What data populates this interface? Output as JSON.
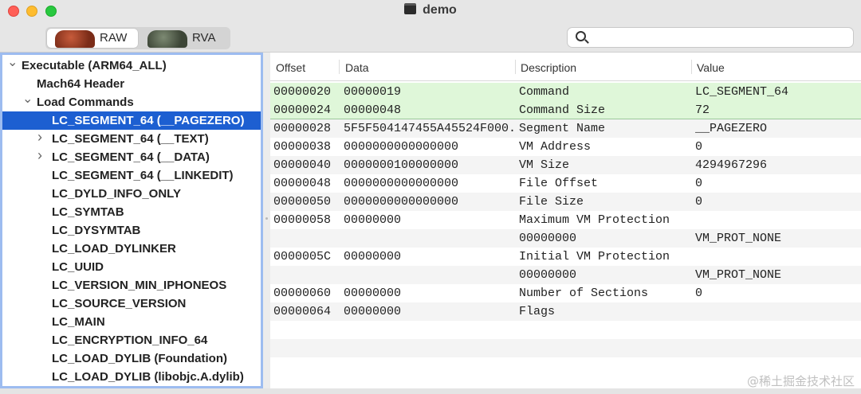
{
  "window": {
    "title": "demo"
  },
  "toolbar": {
    "modes": [
      {
        "label": "RAW",
        "selected": true
      },
      {
        "label": "RVA",
        "selected": false
      }
    ],
    "search": {
      "value": "",
      "placeholder": ""
    }
  },
  "tree": {
    "selected_index": 3,
    "items": [
      {
        "label": "Executable  (ARM64_ALL)",
        "depth": 0,
        "expander": "open"
      },
      {
        "label": "Mach64 Header",
        "depth": 1,
        "expander": "none"
      },
      {
        "label": "Load Commands",
        "depth": 1,
        "expander": "open"
      },
      {
        "label": "LC_SEGMENT_64 (__PAGEZERO)",
        "depth": 2,
        "expander": "none"
      },
      {
        "label": "LC_SEGMENT_64 (__TEXT)",
        "depth": 2,
        "expander": "closed"
      },
      {
        "label": "LC_SEGMENT_64 (__DATA)",
        "depth": 2,
        "expander": "closed"
      },
      {
        "label": "LC_SEGMENT_64 (__LINKEDIT)",
        "depth": 2,
        "expander": "none"
      },
      {
        "label": "LC_DYLD_INFO_ONLY",
        "depth": 2,
        "expander": "none"
      },
      {
        "label": "LC_SYMTAB",
        "depth": 2,
        "expander": "none"
      },
      {
        "label": "LC_DYSYMTAB",
        "depth": 2,
        "expander": "none"
      },
      {
        "label": "LC_LOAD_DYLINKER",
        "depth": 2,
        "expander": "none"
      },
      {
        "label": "LC_UUID",
        "depth": 2,
        "expander": "none"
      },
      {
        "label": "LC_VERSION_MIN_IPHONEOS",
        "depth": 2,
        "expander": "none"
      },
      {
        "label": "LC_SOURCE_VERSION",
        "depth": 2,
        "expander": "none"
      },
      {
        "label": "LC_MAIN",
        "depth": 2,
        "expander": "none"
      },
      {
        "label": "LC_ENCRYPTION_INFO_64",
        "depth": 2,
        "expander": "none"
      },
      {
        "label": "LC_LOAD_DYLIB (Foundation)",
        "depth": 2,
        "expander": "none"
      },
      {
        "label": "LC_LOAD_DYLIB (libobjc.A.dylib)",
        "depth": 2,
        "expander": "none"
      }
    ]
  },
  "table": {
    "columns": [
      "Offset",
      "Data",
      "Description",
      "Value"
    ],
    "rows": [
      {
        "offset": "00000020",
        "data": "00000019",
        "description": "Command",
        "value": "LC_SEGMENT_64",
        "highlight": true
      },
      {
        "offset": "00000024",
        "data": "00000048",
        "description": "Command Size",
        "value": "72",
        "highlight": true
      },
      {
        "offset": "00000028",
        "data": "5F5F504147455A45524F000...",
        "description": "Segment Name",
        "value": "__PAGEZERO",
        "highlight": false
      },
      {
        "offset": "00000038",
        "data": "0000000000000000",
        "description": "VM Address",
        "value": "0",
        "highlight": false
      },
      {
        "offset": "00000040",
        "data": "0000000100000000",
        "description": "VM Size",
        "value": "4294967296",
        "highlight": false
      },
      {
        "offset": "00000048",
        "data": "0000000000000000",
        "description": "File Offset",
        "value": "0",
        "highlight": false
      },
      {
        "offset": "00000050",
        "data": "0000000000000000",
        "description": "File Size",
        "value": "0",
        "highlight": false
      },
      {
        "offset": "00000058",
        "data": "00000000",
        "description": "Maximum VM Protection",
        "value": "",
        "highlight": false
      },
      {
        "offset": "",
        "data": "",
        "description": "00000000",
        "value": "VM_PROT_NONE",
        "highlight": false
      },
      {
        "offset": "0000005C",
        "data": "00000000",
        "description": "Initial VM Protection",
        "value": "",
        "highlight": false
      },
      {
        "offset": "",
        "data": "",
        "description": "00000000",
        "value": "VM_PROT_NONE",
        "highlight": false
      },
      {
        "offset": "00000060",
        "data": "00000000",
        "description": "Number of Sections",
        "value": "0",
        "highlight": false
      },
      {
        "offset": "00000064",
        "data": "00000000",
        "description": "Flags",
        "value": "",
        "highlight": false
      },
      {
        "offset": "",
        "data": "",
        "description": "",
        "value": "",
        "highlight": false
      },
      {
        "offset": "",
        "data": "",
        "description": "",
        "value": "",
        "highlight": false
      },
      {
        "offset": "",
        "data": "",
        "description": "",
        "value": "",
        "highlight": false
      }
    ]
  },
  "watermark": "@稀土掘金技术社区",
  "colors": {
    "selection": "#1d5fd1",
    "highlight_row": "#dff7d9",
    "focus_ring": "#9dbcf0"
  }
}
